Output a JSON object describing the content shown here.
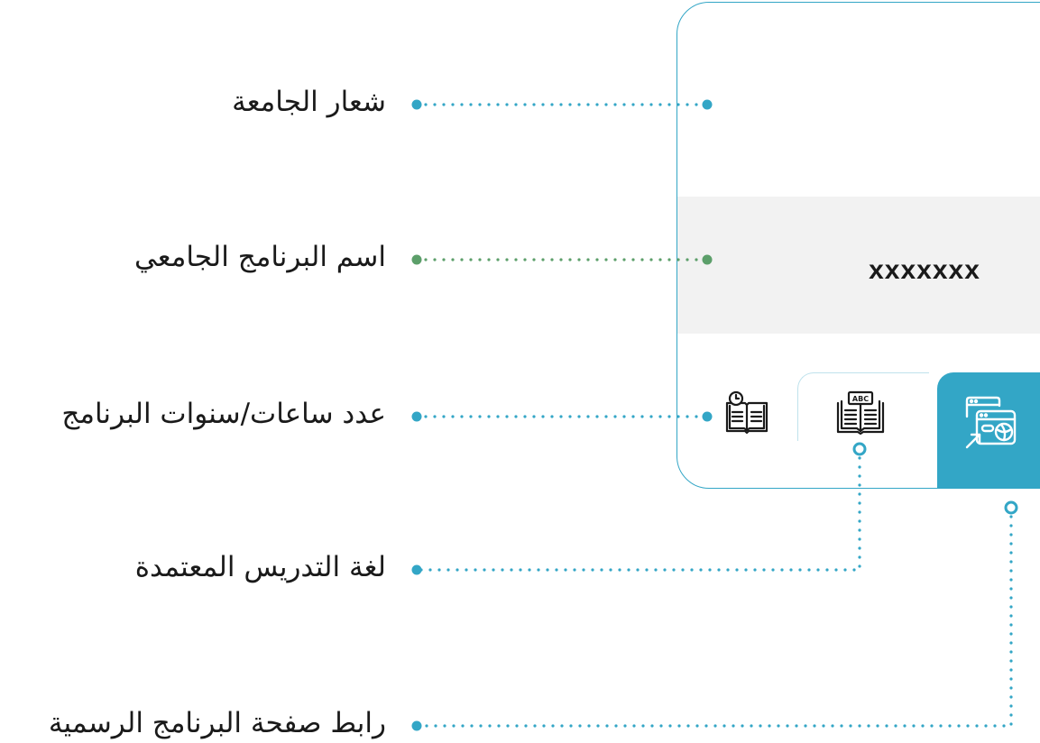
{
  "labels": {
    "logo": "شعار الجامعة",
    "program_name": "اسم البرنامج الجامعي",
    "duration": "عدد ساعات/سنوات البرنامج",
    "language": "لغة التدريس المعتمدة",
    "link": "رابط صفحة البرنامج الرسمية"
  },
  "card": {
    "program_name_value": "xxxxxxx",
    "icons": {
      "duration": "book-clock-icon",
      "language": "abc-book-icon",
      "link": "web-link-icon"
    }
  },
  "colors": {
    "accent_blue": "#33a6c6",
    "accent_green": "#5c9f6a",
    "band_gray": "#f2f2f2",
    "text": "#1a1a1a"
  }
}
